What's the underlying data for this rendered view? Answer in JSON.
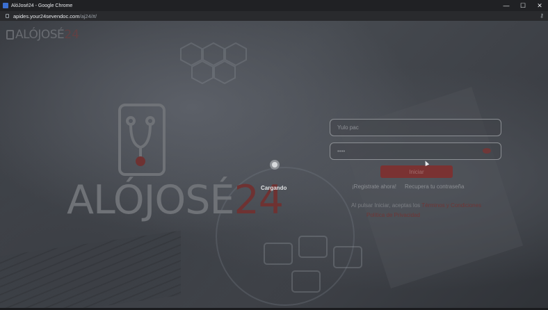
{
  "window": {
    "title": "AlóJosé24 - Google Chrome",
    "minimize": "—",
    "maximize": "☐",
    "close": "✕"
  },
  "address": {
    "domain": "apides.your24sevendoc.com",
    "path": "/aj24/#/"
  },
  "brand": {
    "name": "ALÓJOSÉ",
    "number": "24"
  },
  "loading": {
    "text": "Cargando"
  },
  "login": {
    "username_value": "Yulo pac",
    "password_value": "••••",
    "submit_label": "Iniciar",
    "register_link": "¡Registrate ahora!",
    "recover_link": "Recupera tu contraseña",
    "terms_prefix": "Al pulsar Iniciar, aceptas los",
    "terms_link": "Términos y Condiciones",
    "privacy_link": "Política de Privacidad"
  },
  "colors": {
    "accent": "#7a3232",
    "overlay": "#3a3d43"
  }
}
